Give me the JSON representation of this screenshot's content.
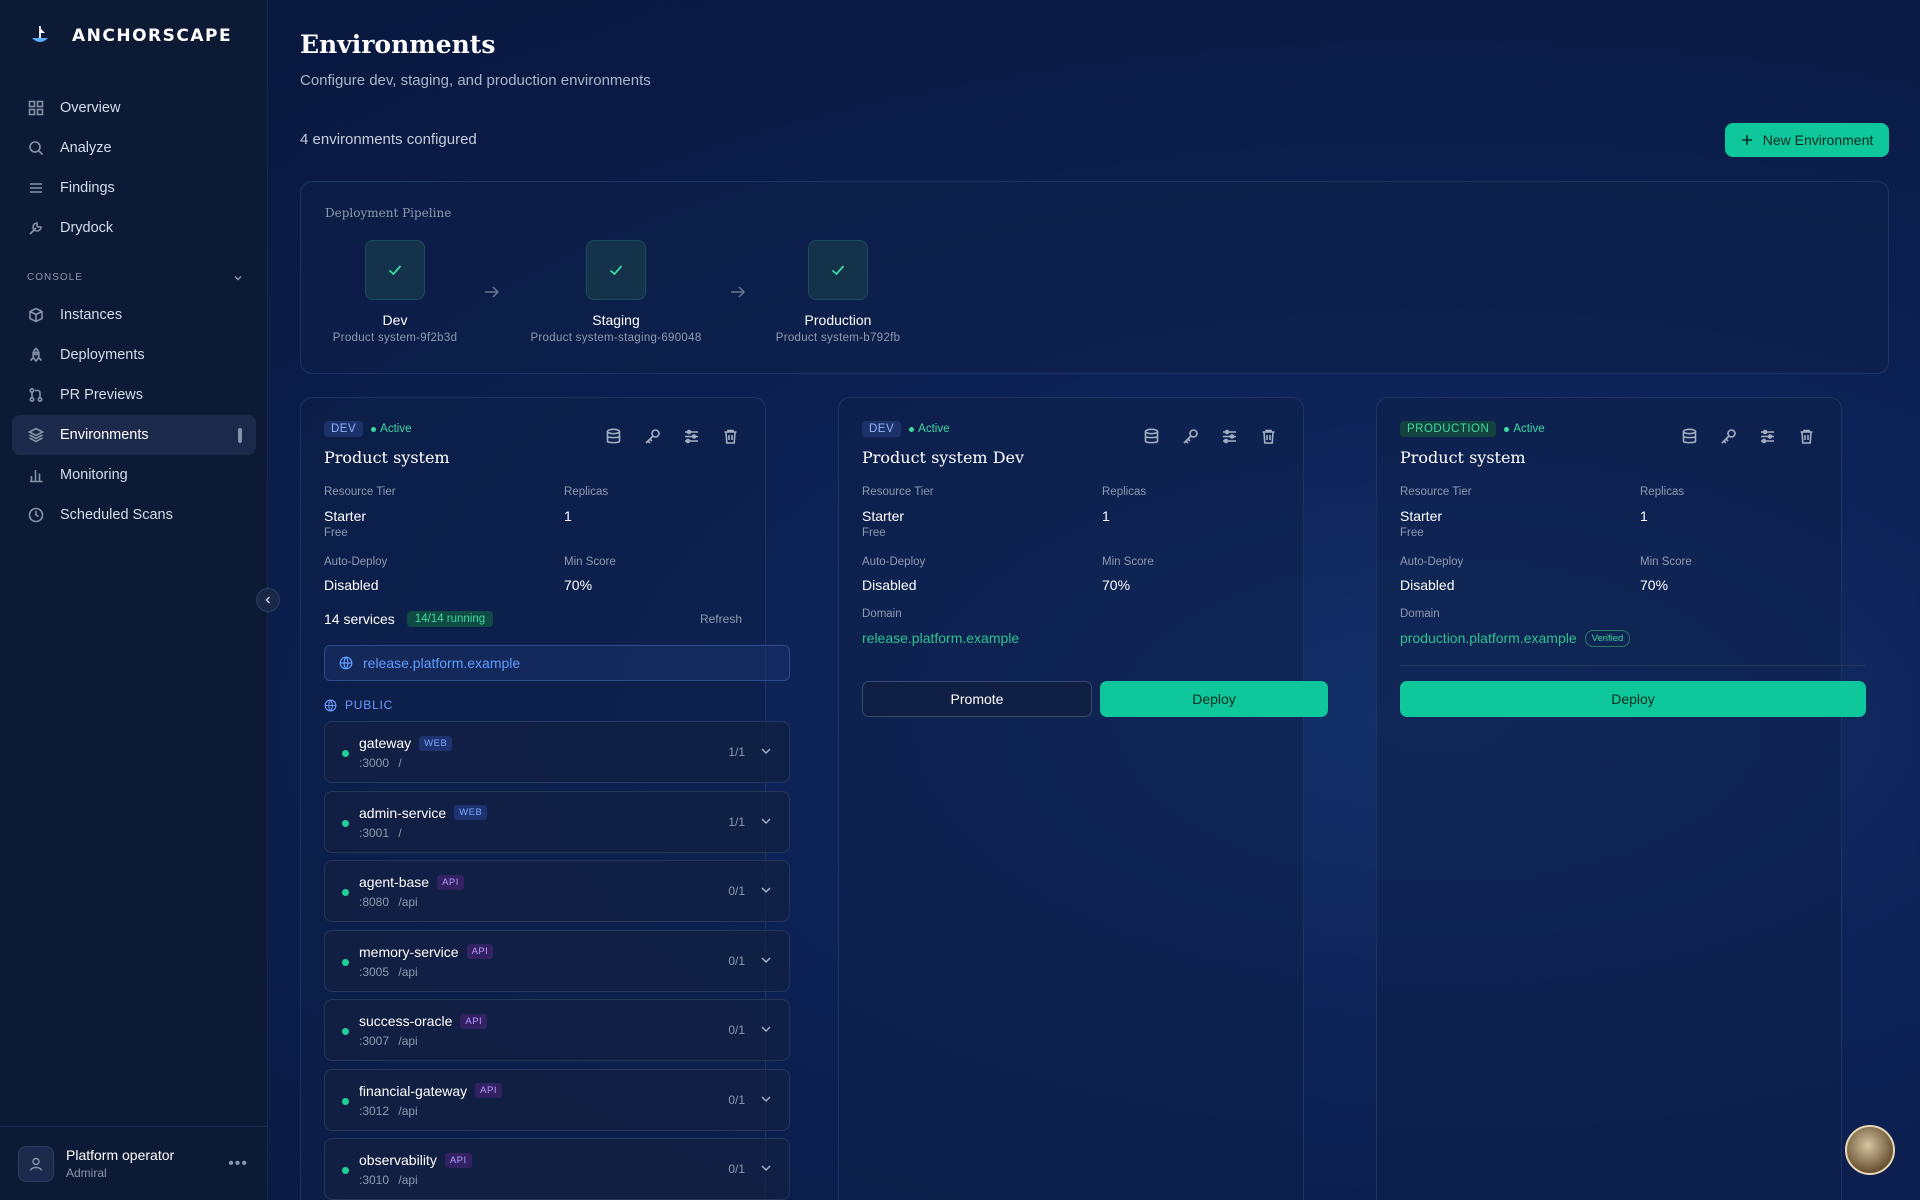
{
  "brand": {
    "name": "ANCHORSCAPE"
  },
  "sidebar": {
    "items": [
      {
        "label": "Overview",
        "icon": "grid-icon"
      },
      {
        "label": "Analyze",
        "icon": "search-icon"
      },
      {
        "label": "Findings",
        "icon": "list-icon"
      },
      {
        "label": "Drydock",
        "icon": "wrench-icon"
      }
    ],
    "section_label": "CONSOLE",
    "console_items": [
      {
        "label": "Instances",
        "icon": "cube-icon"
      },
      {
        "label": "Deployments",
        "icon": "rocket-icon"
      },
      {
        "label": "PR Previews",
        "icon": "git-pull-request-icon"
      },
      {
        "label": "Environments",
        "icon": "layers-icon",
        "active": true
      },
      {
        "label": "Monitoring",
        "icon": "bar-chart-icon"
      },
      {
        "label": "Scheduled Scans",
        "icon": "clock-icon"
      }
    ]
  },
  "user": {
    "name": "Platform operator",
    "role": "Admiral"
  },
  "page": {
    "title": "Environments",
    "subtitle": "Configure dev, staging, and production environments",
    "count_text": "4 environments configured",
    "new_button": "New Environment"
  },
  "pipeline": {
    "label": "Deployment Pipeline",
    "stages": [
      {
        "name": "Dev",
        "id": "Product system-9f2b3d"
      },
      {
        "name": "Staging",
        "id": "Product system-staging-690048"
      },
      {
        "name": "Production",
        "id": "Product system-b792fb"
      }
    ]
  },
  "cards": [
    {
      "env": "DEV",
      "status": "Active",
      "title": "Product system",
      "resource_tier_label": "Resource Tier",
      "resource_tier": "Starter",
      "resource_tier_sub": "Free",
      "replicas_label": "Replicas",
      "replicas": "1",
      "auto_deploy_label": "Auto-Deploy",
      "auto_deploy": "Disabled",
      "min_score_label": "Min Score",
      "min_score": "70%",
      "services_count": "14 services",
      "running": "14/14 running",
      "refresh": "Refresh",
      "domain": "release.platform.example",
      "public_label": "PUBLIC",
      "services": [
        {
          "name": "gateway",
          "type": "WEB",
          "port": ":3000",
          "path": "/",
          "replicas": "1/1"
        },
        {
          "name": "admin-service",
          "type": "WEB",
          "port": ":3001",
          "path": "/",
          "replicas": "1/1"
        },
        {
          "name": "agent-base",
          "type": "API",
          "port": ":8080",
          "path": "/api",
          "replicas": "0/1"
        },
        {
          "name": "memory-service",
          "type": "API",
          "port": ":3005",
          "path": "/api",
          "replicas": "0/1"
        },
        {
          "name": "success-oracle",
          "type": "API",
          "port": ":3007",
          "path": "/api",
          "replicas": "0/1"
        },
        {
          "name": "financial-gateway",
          "type": "API",
          "port": ":3012",
          "path": "/api",
          "replicas": "0/1"
        },
        {
          "name": "observability",
          "type": "API",
          "port": ":3010",
          "path": "/api",
          "replicas": "0/1"
        }
      ]
    },
    {
      "env": "DEV",
      "status": "Active",
      "title": "Product system Dev",
      "resource_tier_label": "Resource Tier",
      "resource_tier": "Starter",
      "resource_tier_sub": "Free",
      "replicas_label": "Replicas",
      "replicas": "1",
      "auto_deploy_label": "Auto-Deploy",
      "auto_deploy": "Disabled",
      "min_score_label": "Min Score",
      "min_score": "70%",
      "domain_label": "Domain",
      "domain": "release.platform.example",
      "promote": "Promote",
      "deploy": "Deploy"
    },
    {
      "env": "PRODUCTION",
      "status": "Active",
      "title": "Product system",
      "resource_tier_label": "Resource Tier",
      "resource_tier": "Starter",
      "resource_tier_sub": "Free",
      "replicas_label": "Replicas",
      "replicas": "1",
      "auto_deploy_label": "Auto-Deploy",
      "auto_deploy": "Disabled",
      "min_score_label": "Min Score",
      "min_score": "70%",
      "domain_label": "Domain",
      "domain": "production.platform.example",
      "verified": "Verified",
      "deploy": "Deploy"
    }
  ],
  "colors": {
    "accent": "#0ec79a",
    "active": "#3fd9a2",
    "link": "#5f9dff",
    "background": "#0a1b45"
  }
}
